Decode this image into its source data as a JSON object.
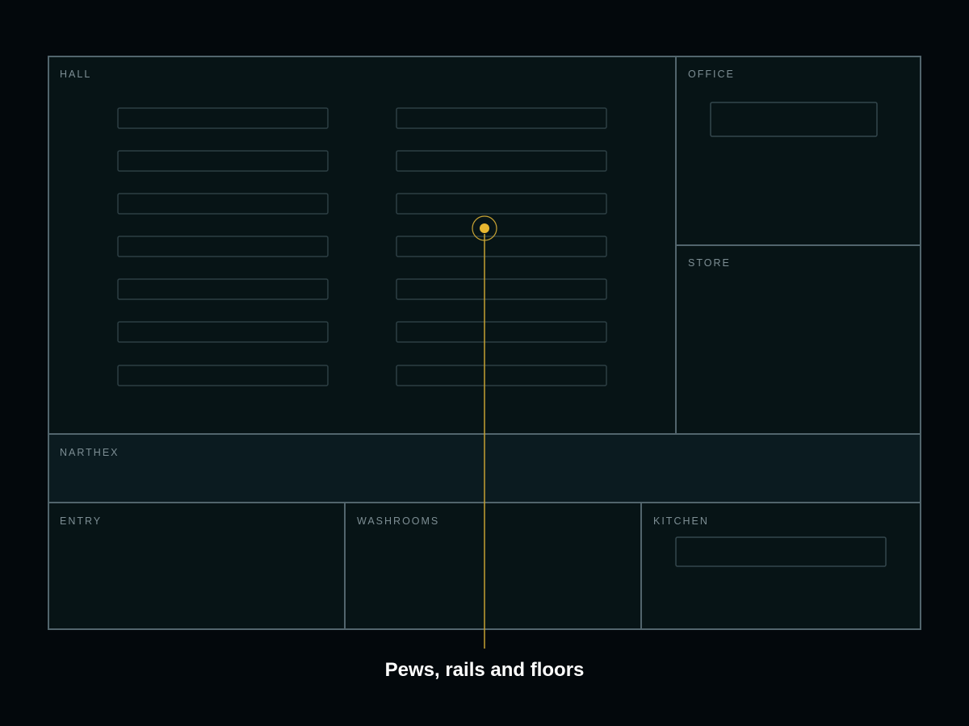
{
  "rooms": {
    "hall": "HALL",
    "office": "OFFICE",
    "store": "STORE",
    "narthex": "NARTHEX",
    "entry": "ENTRY",
    "washrooms": "WASHROOMS",
    "kitchen": "KITCHEN"
  },
  "callout": {
    "label": "Pews, rails and floors"
  },
  "colors": {
    "background": "#03080c",
    "wall": "#52656d",
    "room_fill": "#071416",
    "narthex_fill": "#0b1b20",
    "marker": "#e8b730",
    "callout_text": "#ffffff"
  }
}
